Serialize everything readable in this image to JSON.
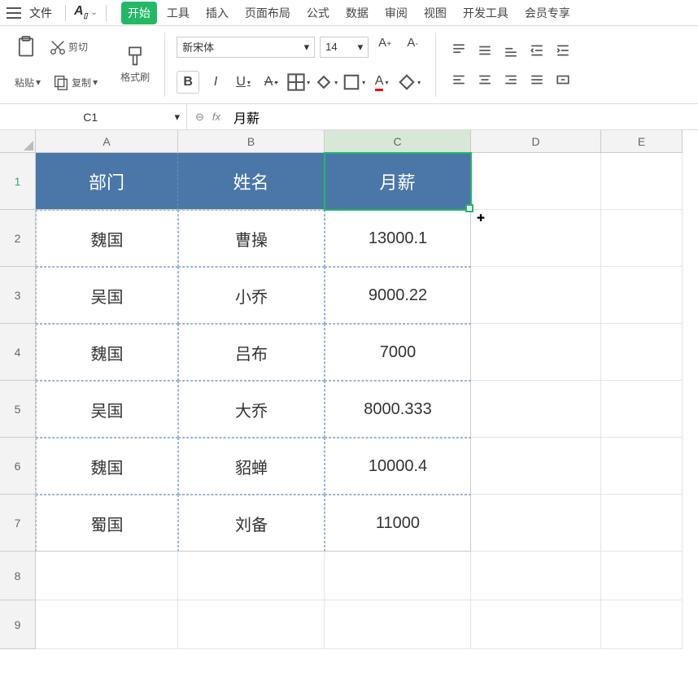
{
  "menu": {
    "file": "文件",
    "tabs": [
      "开始",
      "工具",
      "插入",
      "页面布局",
      "公式",
      "数据",
      "审阅",
      "视图",
      "开发工具",
      "会员专享"
    ],
    "active_tab_index": 0
  },
  "ribbon": {
    "paste": "粘贴",
    "cut": "剪切",
    "copy": "复制",
    "format_painter": "格式刷",
    "font_name": "新宋体",
    "font_size": "14"
  },
  "formula_bar": {
    "cell_ref": "C1",
    "value": "月薪"
  },
  "columns": [
    "A",
    "B",
    "C",
    "D",
    "E"
  ],
  "selected_column": "C",
  "selected_row": "1",
  "table": {
    "headers": [
      "部门",
      "姓名",
      "月薪"
    ],
    "rows": [
      [
        "魏国",
        "曹操",
        "13000.1"
      ],
      [
        "吴国",
        "小乔",
        "9000.22"
      ],
      [
        "魏国",
        "吕布",
        "7000"
      ],
      [
        "吴国",
        "大乔",
        "8000.333"
      ],
      [
        "魏国",
        "貂蝉",
        "10000.4"
      ],
      [
        "蜀国",
        "刘备",
        "11000"
      ]
    ]
  },
  "visible_rows": [
    "1",
    "2",
    "3",
    "4",
    "5",
    "6",
    "7",
    "8",
    "9"
  ]
}
